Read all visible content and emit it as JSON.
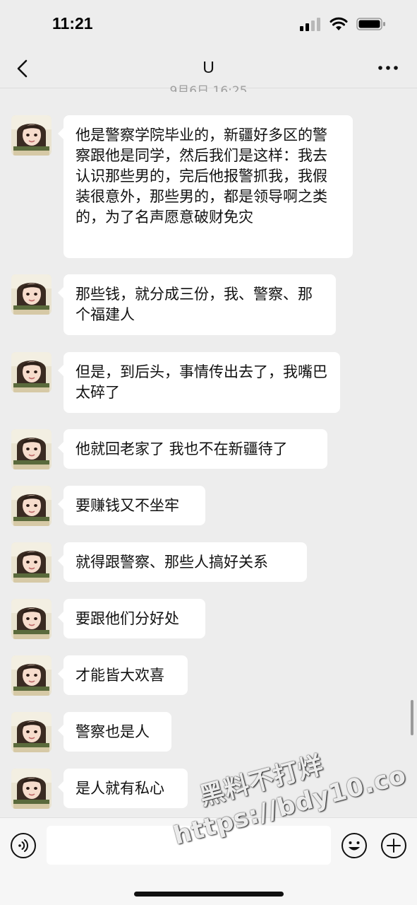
{
  "status_bar": {
    "time": "11:21"
  },
  "nav": {
    "title": "U"
  },
  "timestamp": "9月6日 16:25",
  "messages": [
    {
      "text": "他是警察学院毕业的，新疆好多区的警察跟他是同学，然后我们是这样：我去认识那些男的，完后他报警抓我，我假装很意外，那些男的，都是领导啊之类的，为了名声愿意破财免灾"
    },
    {
      "text": "那些钱，就分成三份，我、警察、那个福建人"
    },
    {
      "text": "但是，到后头，事情传出去了，我嘴巴太碎了"
    },
    {
      "text": "他就回老家了 我也不在新疆待了"
    },
    {
      "text": "要赚钱又不坐牢"
    },
    {
      "text": "就得跟警察、那些人搞好关系"
    },
    {
      "text": "要跟他们分好处"
    },
    {
      "text": "才能皆大欢喜"
    },
    {
      "text": "警察也是人"
    },
    {
      "text": "是人就有私心"
    }
  ],
  "watermark": {
    "line1": "黑料不打烊",
    "line2": "https://bdy10.co"
  },
  "icons": {
    "back": "chevron-left-icon",
    "more": "more-dots-icon",
    "voice": "voice-icon",
    "emoji": "emoji-icon",
    "plus": "plus-icon"
  }
}
